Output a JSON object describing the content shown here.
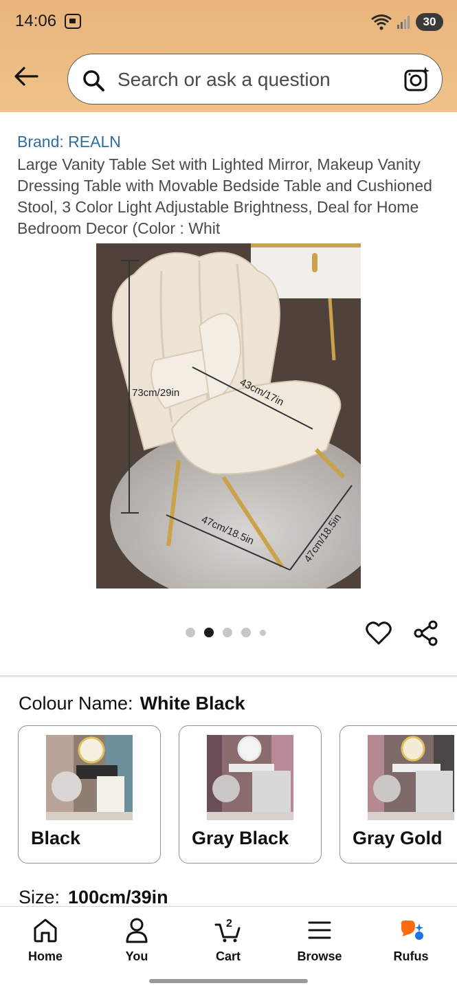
{
  "status": {
    "time": "14:06",
    "battery": "30"
  },
  "search": {
    "placeholder": "Search or ask a question"
  },
  "product": {
    "brand": "Brand: REALN",
    "title": "Large Vanity Table Set with Lighted Mirror, Makeup Vanity Dressing Table with Movable Bedside Table and Cushioned Stool, 3 Color Light Adjustable Brightness, Deal for Home Bedroom Decor (Color : Whit",
    "image_labels": {
      "height": "73cm/29in",
      "seat_width": "43cm/17in",
      "front_width": "47cm/18.5in",
      "side_depth": "47cm/18.5in"
    },
    "carousel": {
      "count": 5,
      "active_index": 1
    }
  },
  "colour": {
    "label": "Colour Name:",
    "selected": "White Black",
    "options": [
      {
        "label": "Black"
      },
      {
        "label": "Gray Black"
      },
      {
        "label": "Gray Gold"
      }
    ]
  },
  "size": {
    "label": "Size:",
    "selected": "100cm/39in"
  },
  "nav": {
    "items": [
      {
        "label": "Home",
        "icon": "home-icon"
      },
      {
        "label": "You",
        "icon": "person-icon"
      },
      {
        "label": "Cart",
        "icon": "cart-icon",
        "badge": "2"
      },
      {
        "label": "Browse",
        "icon": "menu-icon"
      },
      {
        "label": "Rufus",
        "icon": "rufus-icon"
      }
    ]
  },
  "colors": {
    "header": "#f0c38b",
    "link": "#2d6ea3",
    "rufus": "#ff6a13",
    "rufus_accent": "#1a73e8"
  }
}
